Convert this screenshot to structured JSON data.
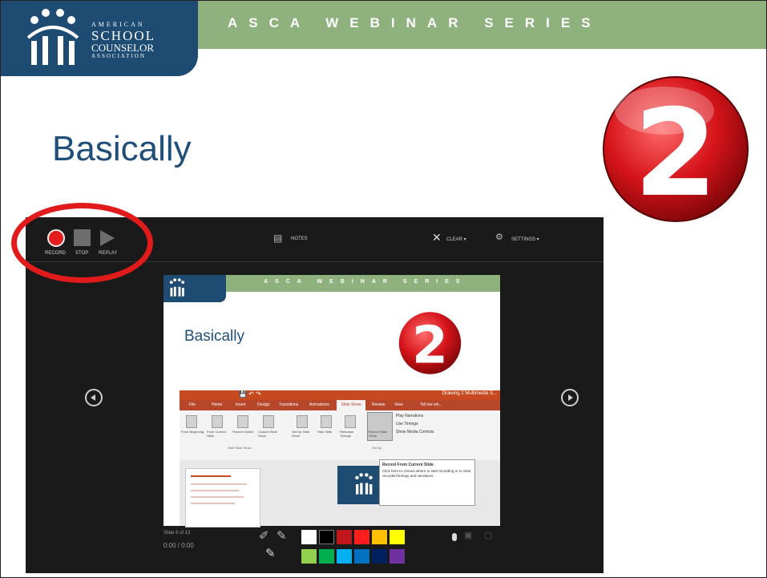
{
  "header": {
    "series_title": "ASCA WEBINAR SERIES",
    "logo_lines": [
      "AMERICAN",
      "SCHOOL",
      "COUNSELOR",
      "ASSOCIATION"
    ]
  },
  "slide": {
    "title": "Basically"
  },
  "recorder": {
    "controls": {
      "record_label": "RECORD",
      "stop_label": "STOP",
      "replay_label": "REPLAY",
      "notes_label": "NOTES",
      "clear_label": "CLEAR ▾",
      "settings_label": "SETTINGS ▾"
    },
    "inner_slide": {
      "series_title": "ASCA WEBINAR SERIES",
      "title": "Basically",
      "ribbon_title": "Drawing 2 Multimedia S...",
      "ribbon_tabs": [
        "File",
        "Home",
        "Insert",
        "Design",
        "Transitions",
        "Animations",
        "Slide Show",
        "Review",
        "View",
        "Tell me wh..."
      ],
      "ribbon_groups": [
        "From Beginning",
        "From Current Slide",
        "Present Online",
        "Custom Slide Show",
        "Set Up Slide Show",
        "Hide Slide",
        "Rehearse Timings",
        "Record Slide Show"
      ],
      "checkboxes": [
        "Play Narrations",
        "Use Timings",
        "Show Media Controls"
      ],
      "group_caption": "Start Slide Show",
      "setup_caption": "Set Up",
      "tooltip_title": "Record From Current Slide",
      "tooltip_body": "Click here to choose where to start recording or to clear recorded timings and narrations."
    },
    "slide_counter": "Slide 6 of 13",
    "timer": "0:00 / 0:00",
    "ink_colors": [
      "#ffffff",
      "#000000",
      "#c0171c",
      "#ff1e1e",
      "#ffc000",
      "#ffff00",
      "#92d050",
      "#00b050",
      "#00b0f0",
      "#0070c0",
      "#002060",
      "#7030a0"
    ]
  },
  "badge_number": "2"
}
